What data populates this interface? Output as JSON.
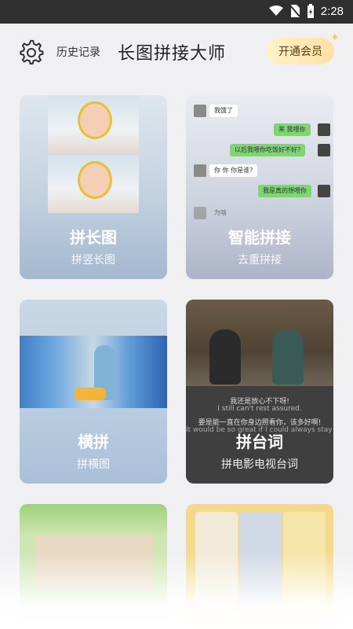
{
  "status_bar": {
    "time": "2:28"
  },
  "header": {
    "history_label": "历史记录",
    "title": "长图拼接大师",
    "vip_label": "开通会员"
  },
  "cards": [
    {
      "label": "拼长图",
      "sub": "拼竖长图"
    },
    {
      "label": "智能拼接",
      "sub": "去重拼接"
    },
    {
      "label": "横拼",
      "sub": "拼横图"
    },
    {
      "label": "拼台词",
      "sub": "拼电影电视台词"
    }
  ],
  "chat_preview": {
    "messages": [
      "我饿了",
      "来 我喂你",
      "以后我喂你吃饭好不好?",
      "你 你 你是谁?",
      "我是真的想喂你",
      "为啥"
    ]
  },
  "subtitle_preview": {
    "line1_cn": "我还是放心不下呀!",
    "line1_en": "I still can't rest assured.",
    "line2_cn": "要是能一直在你身边照看你，该多好啊!",
    "line2_en": "It would be so great if I could always stay with you."
  },
  "colors": {
    "accent_gold": "#ffe0a6",
    "chat_green": "#7ed672"
  }
}
